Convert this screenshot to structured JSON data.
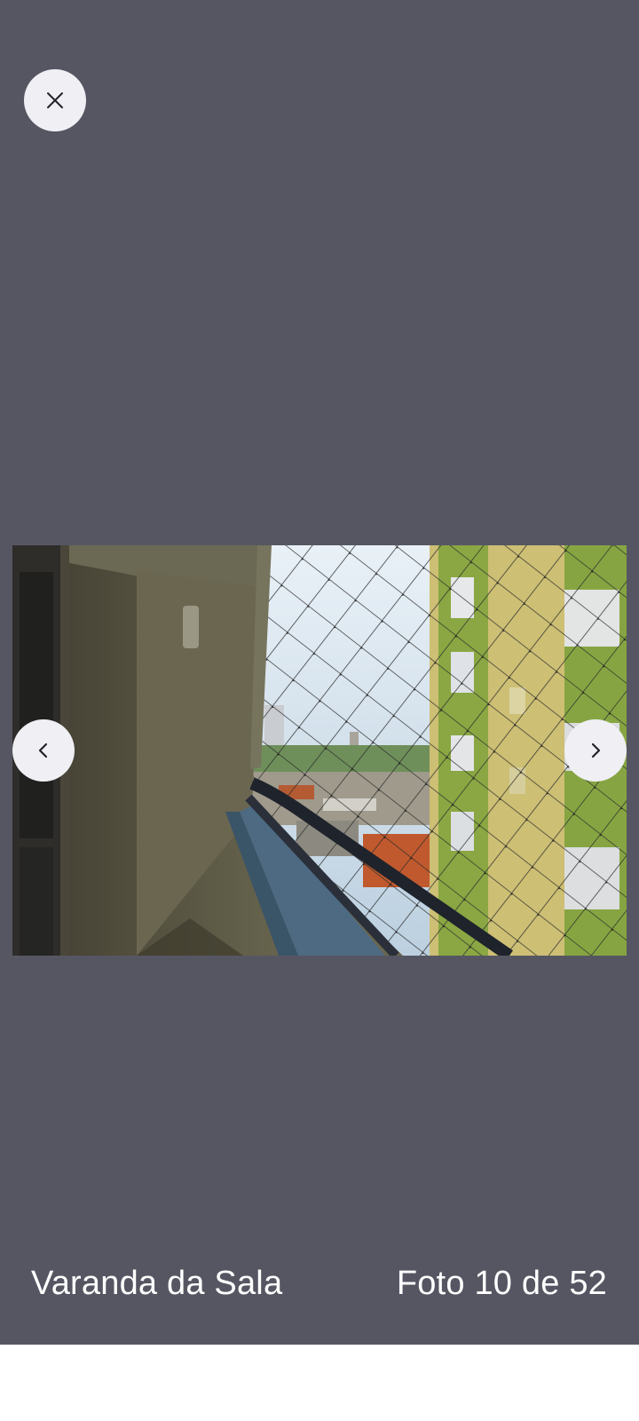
{
  "viewer": {
    "background": "#565663",
    "close_icon": "close-icon",
    "prev_icon": "chevron-left-icon",
    "next_icon": "chevron-right-icon"
  },
  "photo": {
    "subject": "balcony-with-safety-net-photo"
  },
  "caption": {
    "title": "Varanda da Sala",
    "counter": "Foto 10 de 52"
  }
}
